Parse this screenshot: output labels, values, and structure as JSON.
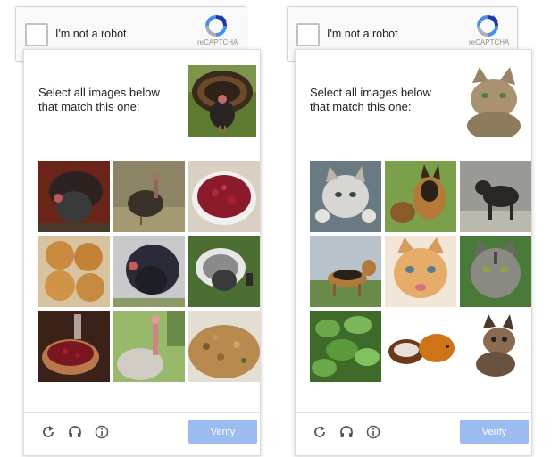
{
  "colors": {
    "accent": "#4a90e2",
    "verify_disabled": "#9cbbf0",
    "anchor_bg": "#f9f9f9"
  },
  "widgets": [
    {
      "checkbox_label": "I'm not a robot",
      "logo_text": "reCAPTCHA",
      "prompt": "Select all images below that match this one:",
      "sample_image": "turkey",
      "tiles": [
        "turkey",
        "wild-turkey",
        "cranberry-sauce",
        "bread-rolls",
        "turkey",
        "turkey",
        "cranberries-wine",
        "turkey",
        "stuffing"
      ],
      "icons": [
        "reload-icon",
        "headphones-icon",
        "info-icon"
      ],
      "verify_label": "Verify"
    },
    {
      "checkbox_label": "I'm not a robot",
      "logo_text": "reCAPTCHA",
      "prompt": "Select all images below that match this one:",
      "sample_image": "cat",
      "tiles": [
        "kitten",
        "german-shepherd",
        "dog",
        "german-shepherd",
        "kitten",
        "tabby-cat",
        "plant",
        "guinea-pigs",
        "kitten"
      ],
      "icons": [
        "reload-icon",
        "headphones-icon",
        "info-icon"
      ],
      "verify_label": "Verify"
    }
  ]
}
